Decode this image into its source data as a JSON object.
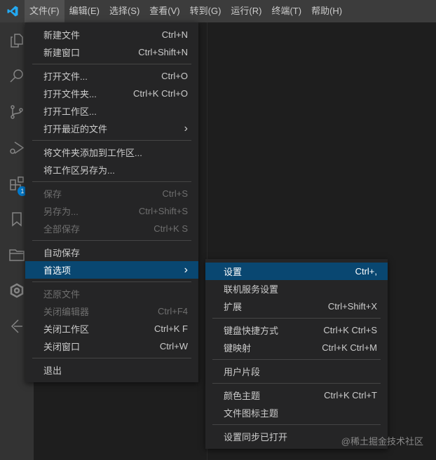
{
  "menubar": [
    "文件(F)",
    "编辑(E)",
    "选择(S)",
    "查看(V)",
    "转到(G)",
    "运行(R)",
    "终端(T)",
    "帮助(H)"
  ],
  "activity": {
    "badge": "1"
  },
  "file_menu": [
    [
      {
        "label": "新建文件",
        "kb": "Ctrl+N"
      },
      {
        "label": "新建窗口",
        "kb": "Ctrl+Shift+N"
      }
    ],
    [
      {
        "label": "打开文件...",
        "kb": "Ctrl+O"
      },
      {
        "label": "打开文件夹...",
        "kb": "Ctrl+K Ctrl+O"
      },
      {
        "label": "打开工作区...",
        "kb": ""
      },
      {
        "label": "打开最近的文件",
        "kb": "›"
      }
    ],
    [
      {
        "label": "将文件夹添加到工作区...",
        "kb": ""
      },
      {
        "label": "将工作区另存为...",
        "kb": ""
      }
    ],
    [
      {
        "label": "保存",
        "kb": "Ctrl+S",
        "disabled": true
      },
      {
        "label": "另存为...",
        "kb": "Ctrl+Shift+S",
        "disabled": true
      },
      {
        "label": "全部保存",
        "kb": "Ctrl+K S",
        "disabled": true
      }
    ],
    [
      {
        "label": "自动保存",
        "kb": ""
      },
      {
        "label": "首选项",
        "kb": "›",
        "selected": true
      }
    ],
    [
      {
        "label": "还原文件",
        "kb": "",
        "disabled": true
      },
      {
        "label": "关闭编辑器",
        "kb": "Ctrl+F4",
        "disabled": true
      },
      {
        "label": "关闭工作区",
        "kb": "Ctrl+K F"
      },
      {
        "label": "关闭窗口",
        "kb": "Ctrl+W"
      }
    ],
    [
      {
        "label": "退出",
        "kb": ""
      }
    ]
  ],
  "prefs_menu": [
    [
      {
        "label": "设置",
        "kb": "Ctrl+,",
        "selected": true
      },
      {
        "label": "联机服务设置",
        "kb": ""
      },
      {
        "label": "扩展",
        "kb": "Ctrl+Shift+X"
      }
    ],
    [
      {
        "label": "键盘快捷方式",
        "kb": "Ctrl+K Ctrl+S"
      },
      {
        "label": "键映射",
        "kb": "Ctrl+K Ctrl+M"
      }
    ],
    [
      {
        "label": "用户片段",
        "kb": ""
      }
    ],
    [
      {
        "label": "颜色主题",
        "kb": "Ctrl+K Ctrl+T"
      },
      {
        "label": "文件图标主题",
        "kb": ""
      }
    ],
    [
      {
        "label": "设置同步已打开",
        "kb": ""
      }
    ]
  ],
  "watermark": "@稀土掘金技术社区"
}
